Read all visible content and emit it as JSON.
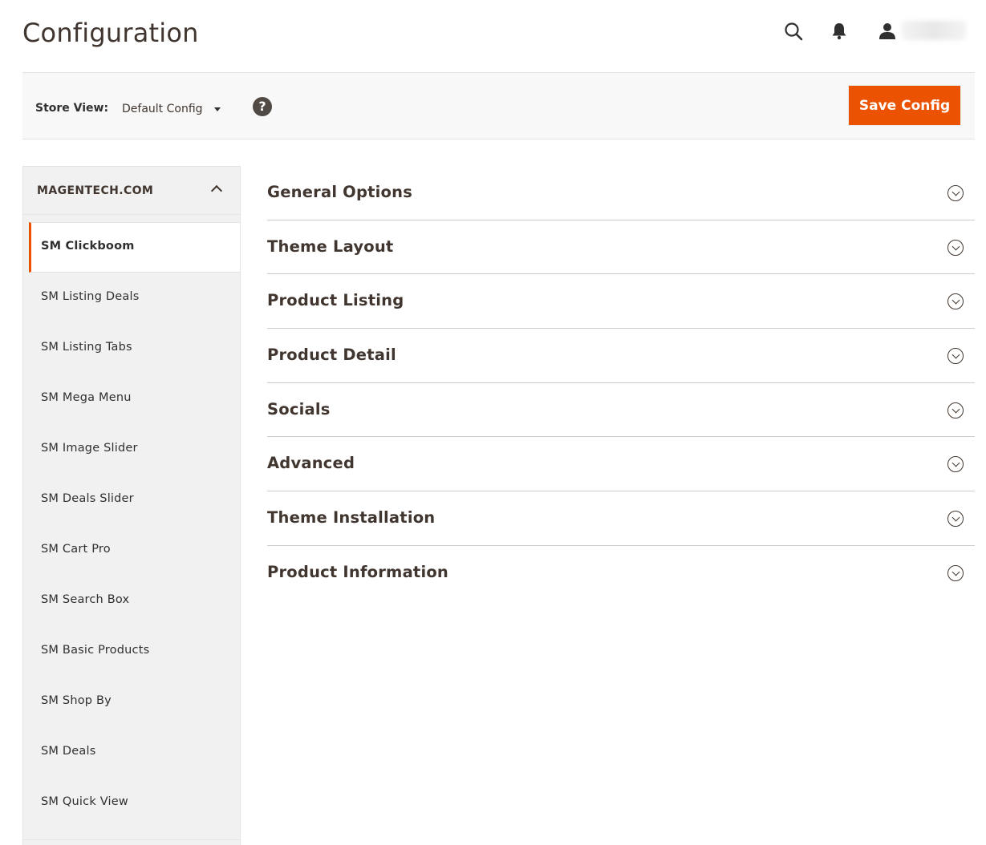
{
  "page": {
    "title": "Configuration"
  },
  "header": {
    "icons": [
      "search-icon",
      "bell-icon",
      "user-icon"
    ]
  },
  "toolbar": {
    "store_view_label": "Store View:",
    "store_view_value": "Default Config",
    "help_glyph": "?",
    "save_label": "Save Config"
  },
  "sidebar": {
    "section_title": "MAGENTECH.COM",
    "items": [
      {
        "label": "SM Clickboom"
      },
      {
        "label": "SM Listing Deals"
      },
      {
        "label": "SM Listing Tabs"
      },
      {
        "label": "SM Mega Menu"
      },
      {
        "label": "SM Image Slider"
      },
      {
        "label": "SM Deals Slider"
      },
      {
        "label": "SM Cart Pro"
      },
      {
        "label": "SM Search Box"
      },
      {
        "label": "SM Basic Products"
      },
      {
        "label": "SM Shop By"
      },
      {
        "label": "SM Deals"
      },
      {
        "label": "SM Quick View"
      }
    ],
    "active_index": 0
  },
  "sections": [
    {
      "title": "General Options"
    },
    {
      "title": "Theme Layout"
    },
    {
      "title": "Product Listing"
    },
    {
      "title": "Product Detail"
    },
    {
      "title": "Socials"
    },
    {
      "title": "Advanced"
    },
    {
      "title": "Theme Installation"
    },
    {
      "title": "Product Information"
    }
  ],
  "colors": {
    "accent": "#eb5202",
    "text": "#41362f",
    "sidebar_bg": "#f1f1f1",
    "toolbar_bg": "#f8f8f8"
  }
}
